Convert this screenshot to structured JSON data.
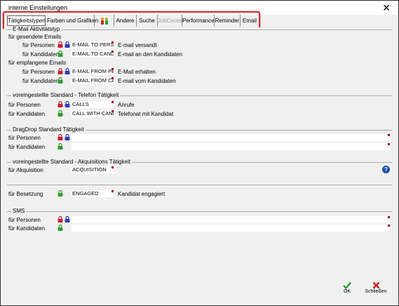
{
  "window": {
    "title": "interne Einstellungen",
    "close_glyph": "✕"
  },
  "tabs": [
    {
      "label": "Tätigkeitstypen",
      "state": "active"
    },
    {
      "label": "Farben und Grafiken",
      "state": "normal"
    },
    {
      "label": "",
      "state": "normal",
      "icon": "people-icon"
    },
    {
      "label": "Andere",
      "state": "normal"
    },
    {
      "label": "Suche",
      "state": "normal"
    },
    {
      "label": "JobCenter",
      "state": "disabled"
    },
    {
      "label": "Performance",
      "state": "normal"
    },
    {
      "label": "Reminder",
      "state": "normal"
    },
    {
      "label": "Email",
      "state": "normal"
    }
  ],
  "email": {
    "section_label": "E-Mail Aktivitätstyp",
    "sent_label": "für gesendete Emails",
    "received_label": "für empfangene Emails",
    "sent_person_label": "für Personen",
    "sent_person_value": "E-MAIL TO PERS",
    "sent_person_desc": "E-mail versandt",
    "sent_cand_label": "für Kandidaten",
    "sent_cand_value": "E-MAIL TO CAND",
    "sent_cand_desc": "E-mail an den Kandidaten",
    "recv_person_label": "für Personen",
    "recv_person_value": "E-MAIL FROM PER",
    "recv_person_desc": "E-Mail erhalten",
    "recv_cand_label": "für Kandidaten",
    "recv_cand_value": "E-MAIL FROM CAN",
    "recv_cand_desc": "E-mail vom Kandidaten"
  },
  "phone": {
    "section_label": "voreingestellte Standard - Telefon Tätigkeit",
    "person_label": "für Personen",
    "person_value": "CALLS",
    "person_desc": "Anrufe",
    "cand_label": "für Kandidaten",
    "cand_value": "CALL WITH CAND",
    "cand_desc": "Telefonat mit Kandidat"
  },
  "dragdrop": {
    "section_label": "DragDrop Standard Tätigkeit",
    "person_label": "für Personen",
    "person_value": "",
    "cand_label": "für Kandidaten",
    "cand_value": ""
  },
  "acquisition": {
    "section_label": "voreingestellte Standard  - Akquisitions Tätigkeit",
    "label": "für Akquisition",
    "value": "ACQUISITION",
    "help_glyph": "?"
  },
  "engagement": {
    "label": "für Besetzung",
    "value": "ENGAGED",
    "desc": "Kandidat engagiert"
  },
  "sms": {
    "section_label": "SMS",
    "person_label": "für Personen",
    "person_value": "",
    "cand_label": "für Kandidaten",
    "cand_value": ""
  },
  "buttons": {
    "ok_label": "OK",
    "close_label": "Schließen"
  },
  "colors": {
    "highlight_border": "#d9262a",
    "lock_red": "#c8202c",
    "lock_blue": "#2a3fb0",
    "lock_green": "#2e9a2e",
    "field_marker": "#a00010",
    "ok_green": "#2e9a2e",
    "close_red": "#c81e1e"
  }
}
